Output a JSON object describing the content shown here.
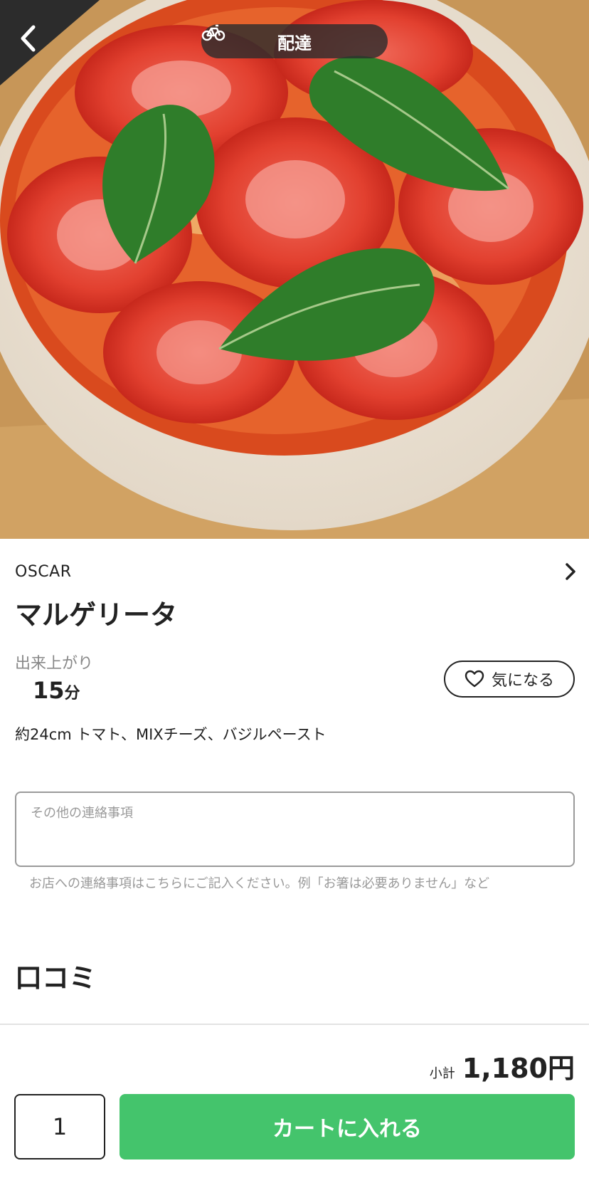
{
  "header": {
    "mode_label": "配達",
    "mode_icon": "bicycle-icon",
    "back_icon": "chevron-left-icon"
  },
  "product": {
    "shop_name": "OSCAR",
    "title": "マルゲリータ",
    "prep_label": "出来上がり",
    "prep_time": "15",
    "prep_unit": "分",
    "description": "約24cm トマト、MIXチーズ、バジルペースト",
    "favorite_label": "気になる"
  },
  "note": {
    "placeholder": "その他の連絡事項",
    "hint": "お店への連絡事項はこちらにご記入ください。例「お箸は必要ありません」など"
  },
  "reviews": {
    "title": "口コミ"
  },
  "footer": {
    "subtotal_label": "小計",
    "subtotal_value": "1,180円",
    "quantity": "1",
    "cart_button_label": "カートに入れる"
  },
  "colors": {
    "accent_green": "#44c46c",
    "pill_bg": "#2d2d2d"
  }
}
